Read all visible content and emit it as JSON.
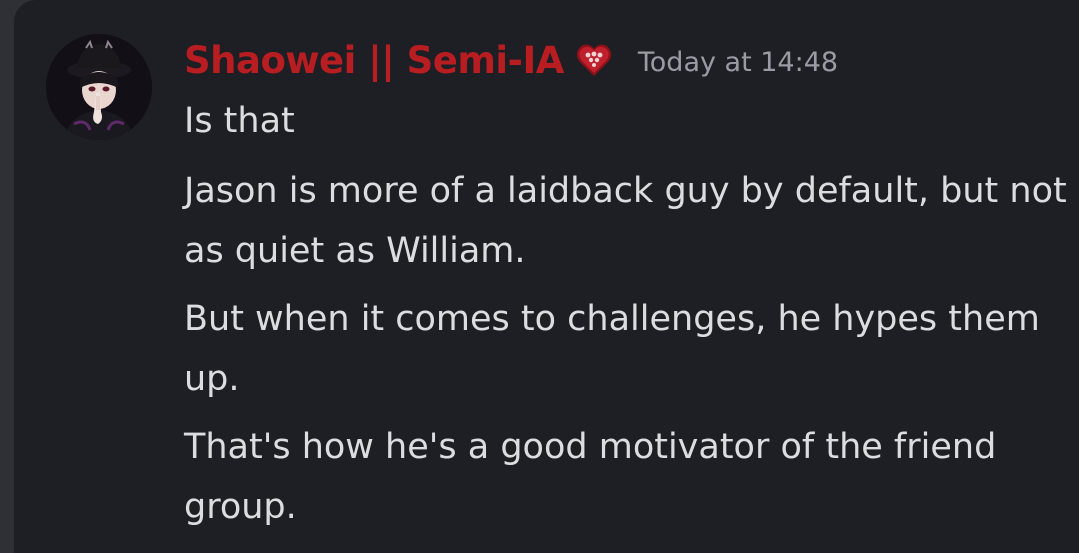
{
  "colors": {
    "username": "#b81d22",
    "timestamp": "#9a9ca4",
    "message_text": "#dcdde1",
    "background": "#1e1f24"
  },
  "message": {
    "author": "Shaowei || Semi-IA",
    "role_icon": "heart-badge-icon",
    "timestamp": "Today at 14:48",
    "lines": [
      "Is that",
      "Jason is more of a laidback guy by default, but not as quiet as William.",
      "But when it comes to challenges, he hypes them up.",
      "That's how he's a good motivator of the friend group."
    ]
  }
}
